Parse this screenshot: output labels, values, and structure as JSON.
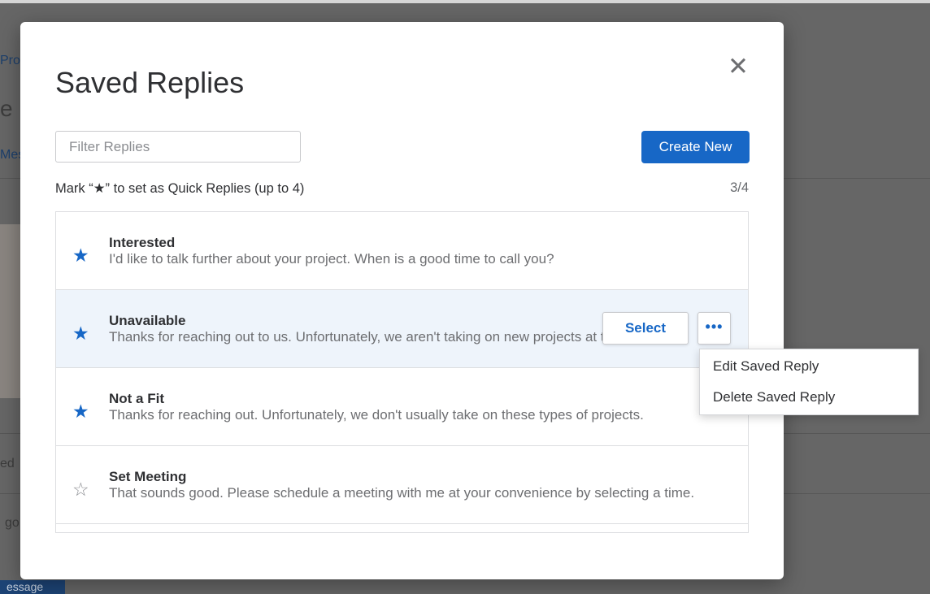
{
  "background": {
    "fragments": [
      "Pro",
      "e",
      "Mes",
      "ed",
      "go",
      "essage"
    ]
  },
  "modal": {
    "title": "Saved Replies",
    "close_glyph": "✕",
    "filter_placeholder": "Filter Replies",
    "create_label": "Create New",
    "hint": "Mark “★” to set as Quick Replies (up to 4)",
    "count": "3/4"
  },
  "replies": [
    {
      "title": "Interested",
      "body": "I'd like to talk further about your project. When is a good time to call you?",
      "starred": true
    },
    {
      "title": "Unavailable",
      "body": "Thanks for reaching out to us. Unfortunately, we aren't taking on new projects at this time.",
      "starred": true
    },
    {
      "title": "Not a Fit",
      "body": "Thanks for reaching out. Unfortunately, we don't usually take on these types of projects.",
      "starred": true
    },
    {
      "title": "Set Meeting",
      "body": "That sounds good. Please schedule a meeting with me at your convenience by selecting a time.",
      "starred": false
    }
  ],
  "row_actions": {
    "select_label": "Select",
    "more_glyph": "•••"
  },
  "menu": {
    "items": [
      "Edit Saved Reply",
      "Delete Saved Reply"
    ]
  },
  "icons": {
    "star_on": "★",
    "star_off": "☆"
  },
  "colors": {
    "accent": "#1767c6",
    "row_hover": "#eef4fb",
    "overlay": "#666666"
  }
}
